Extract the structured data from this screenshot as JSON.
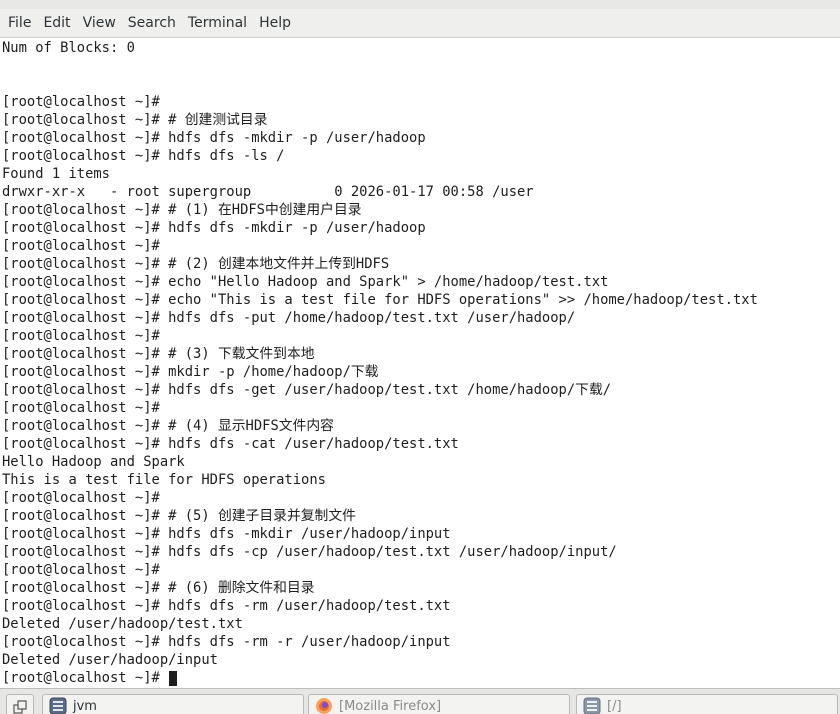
{
  "menubar": {
    "items": [
      "File",
      "Edit",
      "View",
      "Search",
      "Terminal",
      "Help"
    ]
  },
  "terminal": {
    "lines": [
      "Num of Blocks: 0",
      "",
      "",
      "[root@localhost ~]#",
      "[root@localhost ~]# # 创建测试目录",
      "[root@localhost ~]# hdfs dfs -mkdir -p /user/hadoop",
      "[root@localhost ~]# hdfs dfs -ls /",
      "Found 1 items",
      "drwxr-xr-x   - root supergroup          0 2026-01-17 00:58 /user",
      "[root@localhost ~]# # (1) 在HDFS中创建用户目录",
      "[root@localhost ~]# hdfs dfs -mkdir -p /user/hadoop",
      "[root@localhost ~]#",
      "[root@localhost ~]# # (2) 创建本地文件并上传到HDFS",
      "[root@localhost ~]# echo \"Hello Hadoop and Spark\" > /home/hadoop/test.txt",
      "[root@localhost ~]# echo \"This is a test file for HDFS operations\" >> /home/hadoop/test.txt",
      "[root@localhost ~]# hdfs dfs -put /home/hadoop/test.txt /user/hadoop/",
      "[root@localhost ~]#",
      "[root@localhost ~]# # (3) 下载文件到本地",
      "[root@localhost ~]# mkdir -p /home/hadoop/下载",
      "[root@localhost ~]# hdfs dfs -get /user/hadoop/test.txt /home/hadoop/下载/",
      "[root@localhost ~]#",
      "[root@localhost ~]# # (4) 显示HDFS文件内容",
      "[root@localhost ~]# hdfs dfs -cat /user/hadoop/test.txt",
      "Hello Hadoop and Spark",
      "This is a test file for HDFS operations",
      "[root@localhost ~]#",
      "[root@localhost ~]# # (5) 创建子目录并复制文件",
      "[root@localhost ~]# hdfs dfs -mkdir /user/hadoop/input",
      "[root@localhost ~]# hdfs dfs -cp /user/hadoop/test.txt /user/hadoop/input/",
      "[root@localhost ~]#",
      "[root@localhost ~]# # (6) 删除文件和目录",
      "[root@localhost ~]# hdfs dfs -rm /user/hadoop/test.txt",
      "Deleted /user/hadoop/test.txt",
      "[root@localhost ~]# hdfs dfs -rm -r /user/hadoop/input",
      "Deleted /user/hadoop/input"
    ],
    "prompt": "[root@localhost ~]# "
  },
  "taskbar": {
    "show_desktop_icon": "show-desktop-icon",
    "tasks": [
      {
        "label": "jvm",
        "icon": "terminal-icon",
        "active": true
      },
      {
        "label": "[Mozilla Firefox]",
        "icon": "firefox-icon",
        "active": false
      },
      {
        "label": "[/]",
        "icon": "file-manager-icon",
        "active": false
      }
    ]
  }
}
